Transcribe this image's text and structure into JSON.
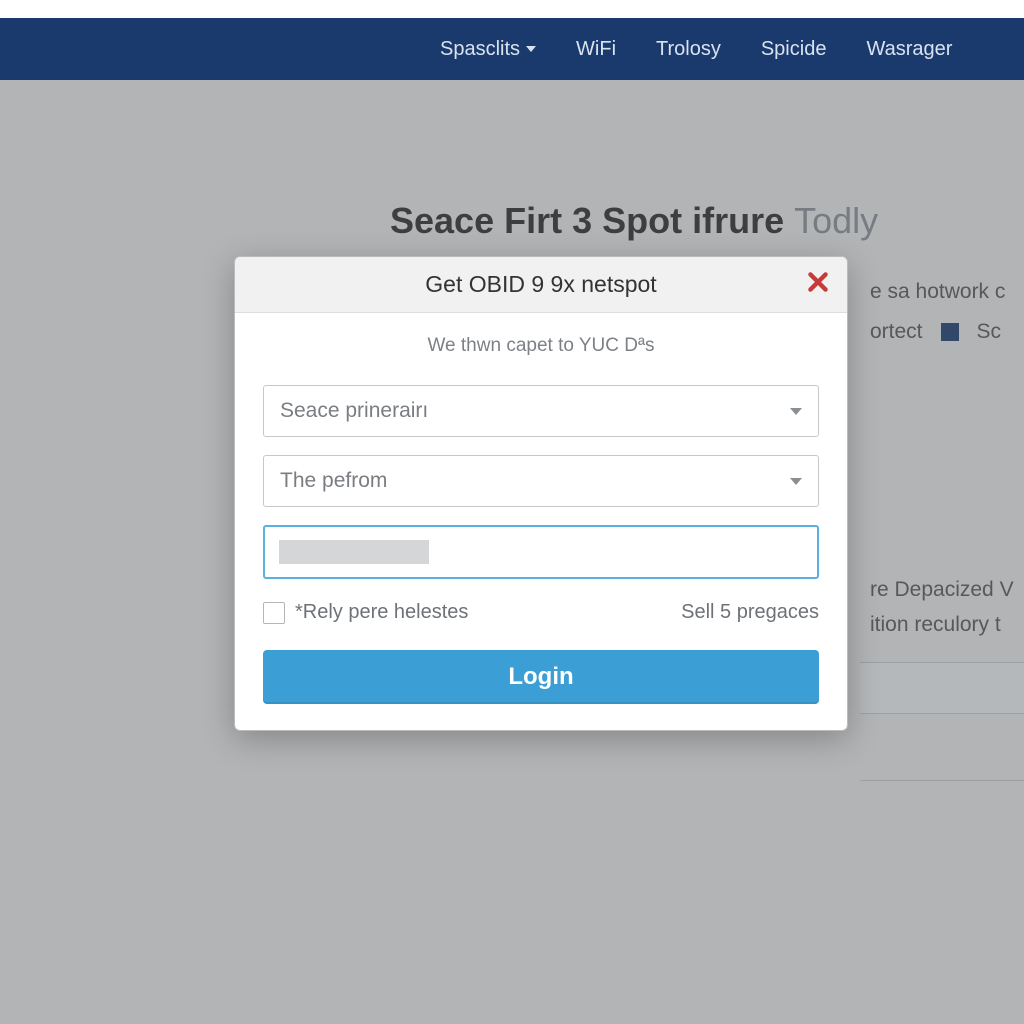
{
  "browser": {
    "url_fragment": ""
  },
  "nav": {
    "items": [
      {
        "label": "Spasclits",
        "has_caret": true
      },
      {
        "label": "WiFi",
        "has_caret": false
      },
      {
        "label": "Trolosy",
        "has_caret": false
      },
      {
        "label": "Spicide",
        "has_caret": false
      },
      {
        "label": "Wasrager",
        "has_caret": false
      }
    ]
  },
  "page": {
    "headline_bold": "Seace Firt 3 Spot ifrure",
    "headline_muted": "Todly",
    "bg_line1": "e sa hotwork c",
    "bg_line2a": "ortect",
    "bg_line2b": "Sc",
    "bg_line3": "re Depacized V",
    "bg_line4": "ition reculory t"
  },
  "modal": {
    "title": "Get OBID 9 9x netspot",
    "subtitle": "We thwn capet to YUC Dªs",
    "select1": "Seace prinerairı",
    "select2": "The pefrom",
    "password_value": "",
    "checkbox_label": "*Rely pere helestes",
    "link_label": "Sell 5 pregaces",
    "login_label": "Login"
  },
  "colors": {
    "navbar": "#1a3a6e",
    "primary_btn": "#3b9fd6",
    "focus_border": "#5ab0de",
    "close_icon": "#c63a38"
  }
}
